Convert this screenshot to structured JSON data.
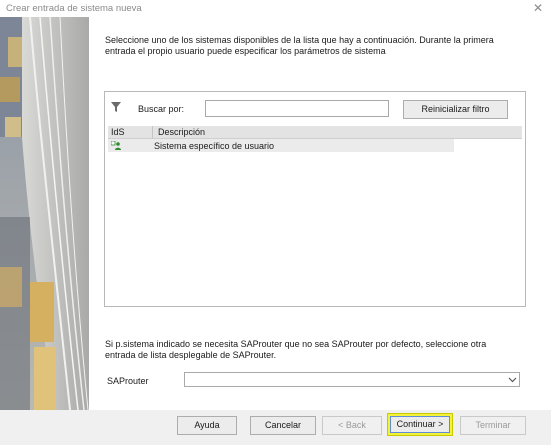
{
  "window": {
    "title": "Crear entrada de sistema nueva"
  },
  "intro_text": "Seleccione uno de los sistemas disponibles de la lista que hay a continuación. Durante la primera entrada el propio usuario puede especificar los parámetros de sistema",
  "filter": {
    "label": "Buscar por:",
    "value": "",
    "reset_label": "Reinicializar filtro"
  },
  "table": {
    "columns": [
      "IdS",
      "Descripción"
    ],
    "rows": [
      {
        "ids": "",
        "description": "Sistema específico de usuario"
      }
    ]
  },
  "hint_text": "Si p.sistema indicado se necesita SAProuter que no sea SAProuter por defecto, seleccione otra entrada de lista desplegable de SAProuter.",
  "saprouter": {
    "label": "SAProuter",
    "value": ""
  },
  "buttons": {
    "help": "Ayuda",
    "cancel": "Cancelar",
    "back": "< Back",
    "continue": "Continuar >",
    "finish": "Terminar"
  },
  "colors": {
    "highlight": "#f2f23a",
    "focus_border": "#5f8ed6",
    "footer_bg": "#f0f0f0"
  }
}
